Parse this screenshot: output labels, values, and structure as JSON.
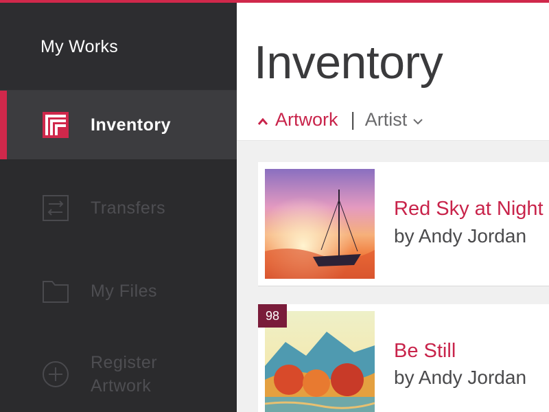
{
  "sidebar": {
    "header": "My Works",
    "items": [
      {
        "label": "Inventory",
        "icon": "inventory-icon",
        "active": true
      },
      {
        "label": "Transfers",
        "icon": "transfers-icon"
      },
      {
        "label": "My Files",
        "icon": "folder-icon"
      },
      {
        "label": "Register\nArtwork",
        "icon": "plus-circle-icon"
      }
    ]
  },
  "main": {
    "title": "Inventory",
    "sort": {
      "active": "Artwork",
      "active_direction": "ascending",
      "separator": "|",
      "other": "Artist"
    },
    "cards": [
      {
        "title": "Red Sky at Night",
        "artist": "by Andy Jordan"
      },
      {
        "title": "Be Still",
        "artist": "by Andy Jordan",
        "badge": "98"
      }
    ]
  },
  "colors": {
    "accent": "#d0284b",
    "sidebar_bg": "#2b2b2d",
    "badge": "#7a1c3a"
  }
}
